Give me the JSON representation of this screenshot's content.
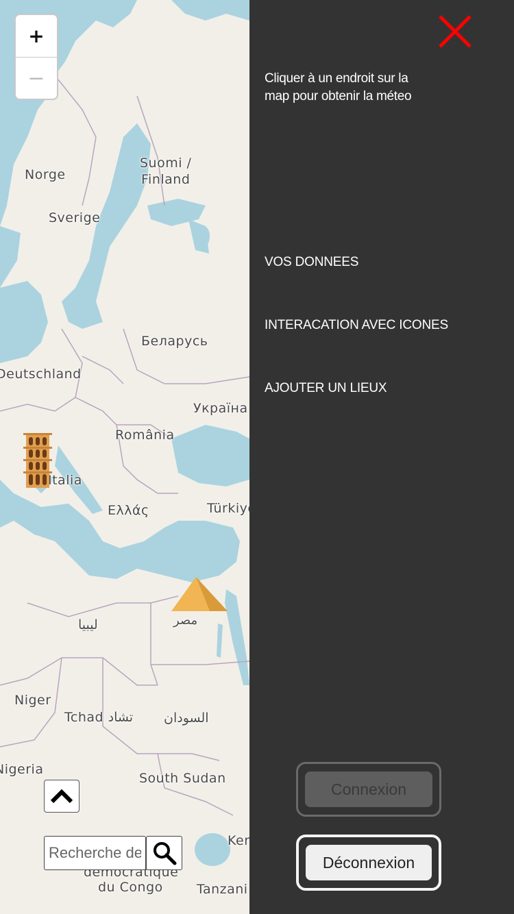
{
  "map": {
    "zoom_in": "+",
    "zoom_out": "−",
    "labels": {
      "norge": "Norge",
      "suomi": "Suomi /",
      "finland": "Finland",
      "sverige": "Sverige",
      "belarus": "Беларусь",
      "deutschland": "Deutschland",
      "ukraina": "Україна",
      "romania": "România",
      "italia": "Italia",
      "ellas": "Ελλάς",
      "turkiye": "Türkiye",
      "libya": "ليبيا",
      "misr": "مصر",
      "niger": "Niger",
      "tchad": "Tchad تشاد",
      "sudan": "السودان",
      "nigeria": "Nigeria",
      "south_sudan": "South Sudan",
      "kenya": "Ker",
      "rdc1": "démocratique",
      "rdc2": "du Congo",
      "tanzania": "Tanzani"
    },
    "markers": [
      "colosseum-icon",
      "pyramid-icon"
    ]
  },
  "search": {
    "placeholder": "Recherche de"
  },
  "panel": {
    "hint": "Cliquer à un endroit sur la map pour obtenir la méteo",
    "menu": [
      "VOS DONNEES",
      "INTERACATION AVEC ICONES",
      "AJOUTER UN LIEUX"
    ],
    "connexion": "Connexion",
    "deconnexion": "Déconnexion"
  },
  "colors": {
    "panel_bg": "#333333",
    "close": "#ff0000",
    "water": "#aad3df",
    "land": "#f2efe9"
  }
}
